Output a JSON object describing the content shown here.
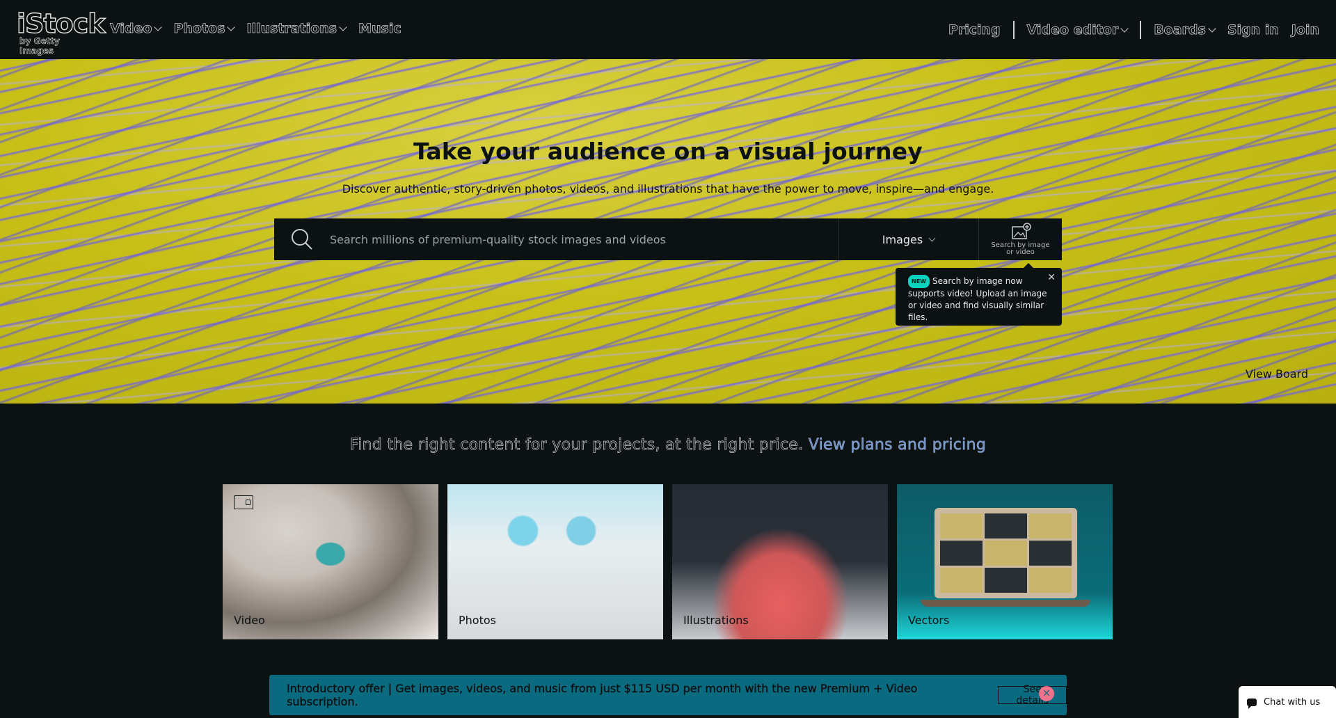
{
  "brand": {
    "logo_word": "iStock",
    "logo_sub": "by Getty Images"
  },
  "nav": {
    "left": [
      {
        "label": "Video"
      },
      {
        "label": "Photos"
      },
      {
        "label": "Illustrations"
      },
      {
        "label": "Music"
      }
    ],
    "right": {
      "pricing": "Pricing",
      "video_editor": "Video editor",
      "boards": "Boards",
      "sign_in": "Sign in",
      "join": "Join"
    }
  },
  "hero": {
    "title": "Take your audience on a visual journey",
    "subtitle": "Discover authentic, story-driven photos, videos, and illustrations that have the power to move, inspire—and engage.",
    "search_placeholder": "Search millions of premium-quality stock images and videos",
    "search_type": "Images",
    "image_search_label": "Search by image or video",
    "tooltip_badge": "NEW",
    "tooltip_text": "Search by image now supports video! Upload an image or video and find visually similar files.",
    "view_board": "View Board"
  },
  "pricing_line": {
    "text": "Find the right content for your projects, at the right price.",
    "link": "View plans and pricing"
  },
  "cards": [
    {
      "label": "Video"
    },
    {
      "label": "Photos"
    },
    {
      "label": "Illustrations"
    },
    {
      "label": "Vectors"
    }
  ],
  "promo": {
    "text": "Introductory offer | Get images, videos, and music from just $115 USD per month with the new Premium + Video subscription.",
    "button": "See details"
  },
  "chat": {
    "label": "Chat with us"
  }
}
